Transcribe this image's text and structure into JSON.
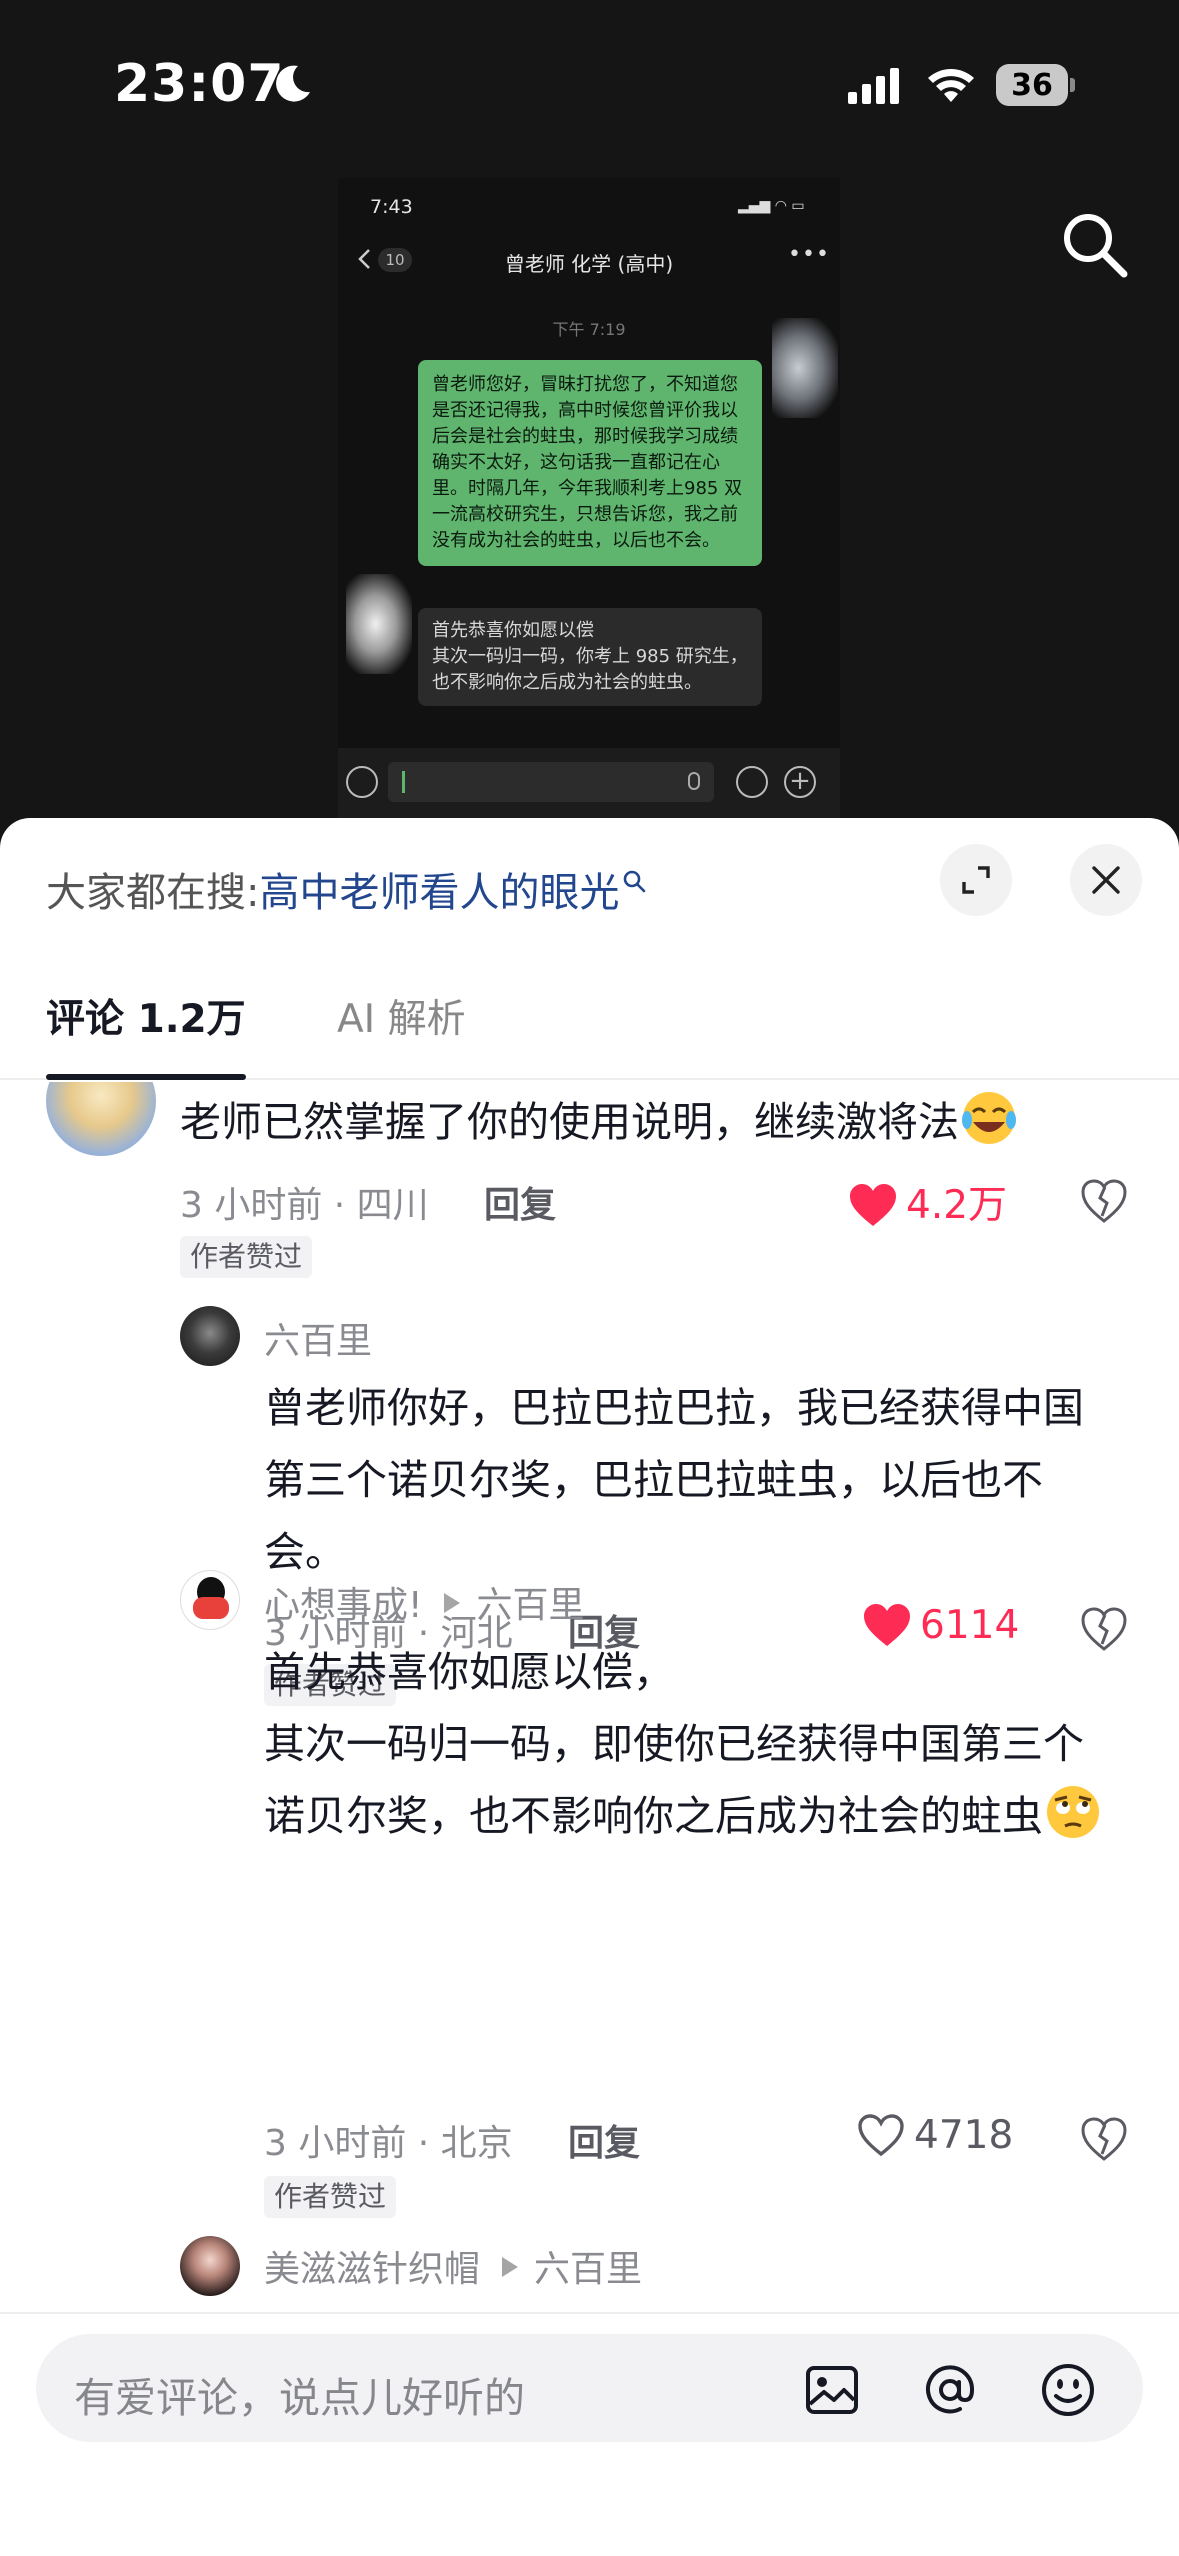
{
  "status_bar": {
    "time": "23:07",
    "battery": "36"
  },
  "chat_screenshot": {
    "time": "7:43",
    "back_badge": "10",
    "title": "曾老师 化学 (高中)",
    "timestamp": "下午 7:19",
    "sent_message": "曾老师您好，冒昧打扰您了，不知道您是否还记得我，高中时候您曾评价我以后会是社会的蛀虫，那时候我学习成绩确实不太好，这句话我一直都记在心里。时隔几年，今年我顺利考上985 双一流高校研究生，只想告诉您，我之前没有成为社会的蛀虫，以后也不会。",
    "reply_message": "首先恭喜你如愿以偿\n其次一码归一码，你考上 985 研究生，也不影响你之后成为社会的蛀虫。"
  },
  "panel": {
    "hot_search_prefix": "大家都在搜:",
    "hot_search_query": "高中老师看人的眼光",
    "tabs": [
      {
        "label": "评论 1.2万"
      },
      {
        "label": "AI 解析"
      }
    ]
  },
  "comments": [
    {
      "text": "老师已然掌握了你的使用说明，继续激将法",
      "emoji": "laugh-cry",
      "meta": "3 小时前 · 四川",
      "reply": "回复",
      "likes": "4.2万",
      "liked": true,
      "badge": "作者赞过"
    },
    {
      "user": "六百里",
      "text": "曾老师你好，巴拉巴拉巴拉，我已经获得中国第三个诺贝尔奖，巴拉巴拉蛀虫，以后也不会。",
      "meta": "3 小时前 · 河北",
      "reply": "回复",
      "likes": "6114",
      "liked": true,
      "badge": "作者赞过"
    },
    {
      "user": "心想事成!",
      "reply_to": "六百里",
      "text_line1": "首先恭喜你如愿以偿，",
      "text_rest": "其次一码归一码，即使你已经获得中国第三个诺贝尔奖，也不影响你之后成为社会的蛀虫",
      "emoji": "eye-roll",
      "meta": "3 小时前 · 北京",
      "reply": "回复",
      "likes": "4718",
      "liked": false,
      "badge": "作者赞过"
    },
    {
      "user": "美滋滋针织帽",
      "reply_to": "六百里"
    }
  ],
  "input": {
    "placeholder": "有爱评论，说点儿好听的"
  },
  "colors": {
    "like_red": "#fe2c55",
    "link_blue": "#23478e",
    "wechat_green": "#5fb56e"
  }
}
